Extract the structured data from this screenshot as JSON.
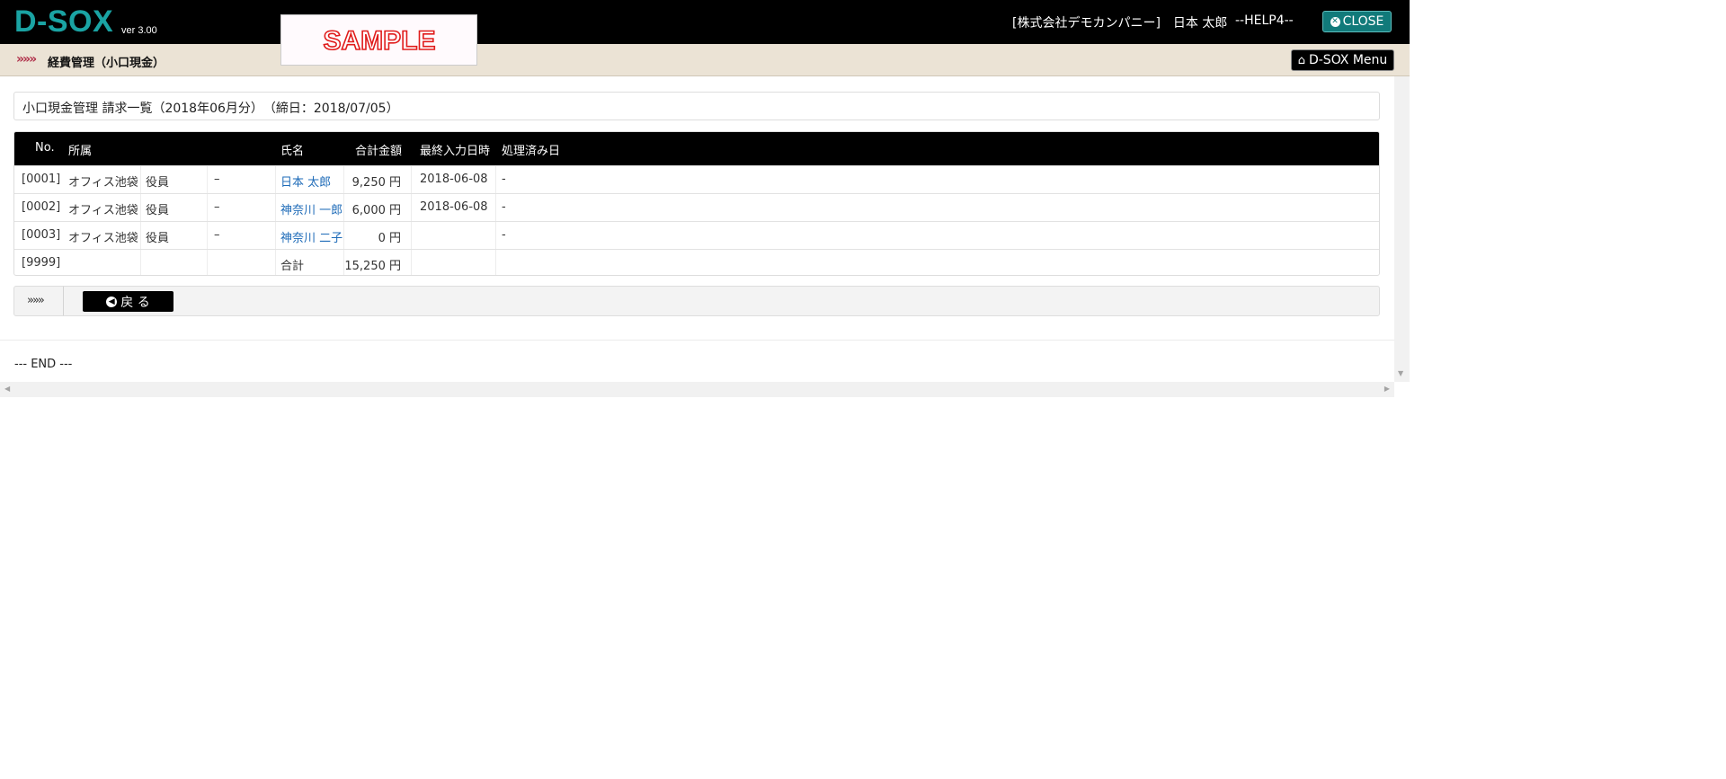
{
  "header": {
    "logo": "D-SOX",
    "version": "ver 3.00",
    "watermark": "SAMPLE",
    "company_user": "[株式会社デモカンパニー]　日本 太郎",
    "help": "--HELP4--",
    "close_label": "CLOSE"
  },
  "subheader": {
    "arrows": "»»»",
    "title": "経費管理（小口現金）",
    "menu_label": "D-SOX Menu"
  },
  "main": {
    "headline": "小口現金管理 請求一覧（2018年06月分）　（締日：2018/07/05）",
    "table": {
      "columns": [
        "No.",
        "所属",
        "氏名",
        "合計金額",
        "最終入力日時",
        "処理済み日"
      ],
      "rows": [
        {
          "no": "[0001]",
          "dept": "オフィス池袋",
          "role": "役員",
          "dash": "–",
          "name": "日本 太郎",
          "amount": "9,250 円",
          "last_input": "2018-06-08",
          "processed": "-"
        },
        {
          "no": "[0002]",
          "dept": "オフィス池袋",
          "role": "役員",
          "dash": "–",
          "name": "神奈川 一郎",
          "amount": "6,000 円",
          "last_input": "2018-06-08",
          "processed": "-"
        },
        {
          "no": "[0003]",
          "dept": "オフィス池袋",
          "role": "役員",
          "dash": "–",
          "name": "神奈川 二子",
          "amount": "0 円",
          "last_input": "",
          "processed": "-"
        },
        {
          "no": "[9999]",
          "dept": "",
          "role": "",
          "dash": "",
          "name": "合計",
          "amount": "15,250 円",
          "last_input": "",
          "processed": ""
        }
      ]
    },
    "actions": {
      "arrows": "»»»",
      "back_label": "戻 る"
    },
    "end_text": "--- END ---"
  },
  "colors": {
    "logo": "#1aa3a3",
    "close_button": "#117a7a",
    "subbar": "#ebe3d5",
    "link": "#1e6bb8",
    "watermark": "#e01c1c"
  }
}
